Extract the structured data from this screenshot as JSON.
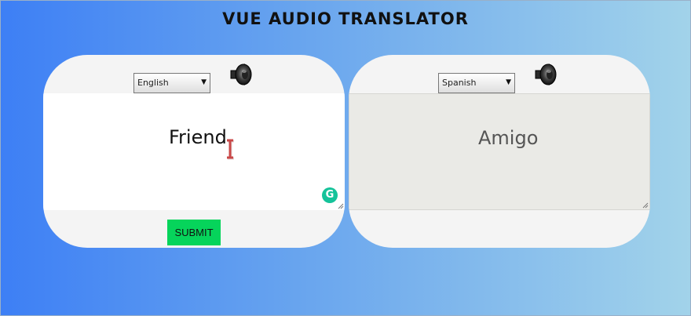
{
  "app": {
    "title": "VUE AUDIO TRANSLATOR"
  },
  "source": {
    "language": "English",
    "text": "Friend",
    "speaker_icon": "speaker-icon",
    "submit_label": "SUBMIT"
  },
  "target": {
    "language": "Spanish",
    "text": "Amigo",
    "speaker_icon": "speaker-icon"
  },
  "colors": {
    "submit": "#06d45b",
    "grammarly": "#15c39a",
    "gradient_start": "#3d7ff5",
    "gradient_end": "#a2d3ea"
  }
}
